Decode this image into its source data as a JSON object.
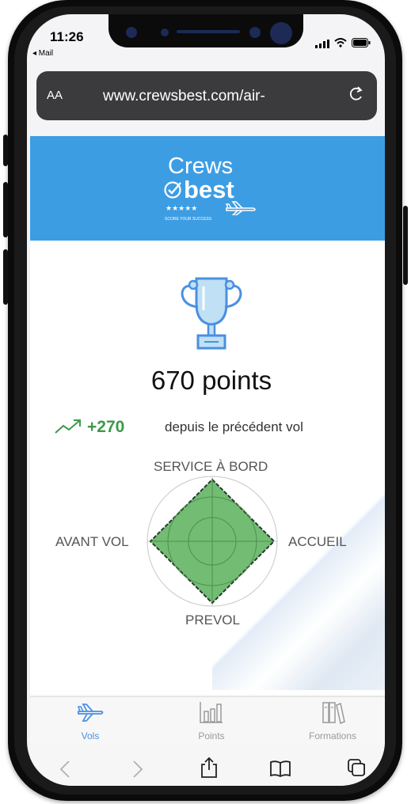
{
  "status_bar": {
    "time": "11:26",
    "back_label": "◂ Mail",
    "indicators": "signal-icon wifi-icon battery-icon"
  },
  "url_bar": {
    "text_size_label": "AA",
    "url": "www.crewsbest.com/air-",
    "reload_icon": "reload-icon"
  },
  "header": {
    "brand_line1": "Crews",
    "brand_line2": "best",
    "stars": "★★★★★",
    "tagline": "SCORE YOUR SUCCESS",
    "background_color": "#3d9de3"
  },
  "summary": {
    "points_text": "670  points",
    "gain_value": "+270",
    "gain_label": "depuis le précédent vol",
    "gain_color": "#3d9a4a"
  },
  "radar": {
    "axes": [
      "SERVICE À BORD",
      "ACCUEIL",
      "PREVOL",
      "AVANT VOL"
    ],
    "fill_color": "#6bb86b"
  },
  "tabs": [
    {
      "label": "Vols",
      "icon": "airplane-icon",
      "active": true
    },
    {
      "label": "Points",
      "icon": "bar-chart-icon",
      "active": false
    },
    {
      "label": "Formations",
      "icon": "books-icon",
      "active": false
    }
  ],
  "accent_color": "#4a90e2"
}
